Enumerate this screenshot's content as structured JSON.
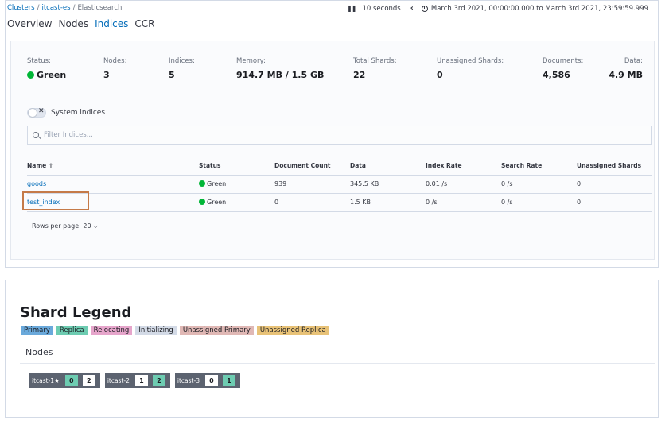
{
  "breadcrumb": [
    "Clusters",
    "itcast-es",
    "Elasticsearch"
  ],
  "time": {
    "refresh": "10 seconds",
    "range": "March 3rd 2021, 00:00:00.000 to March 3rd 2021, 23:59:59.999"
  },
  "tabs": [
    "Overview",
    "Nodes",
    "Indices",
    "CCR"
  ],
  "stats": [
    {
      "label": "Status:",
      "value": "Green"
    },
    {
      "label": "Nodes:",
      "value": "3"
    },
    {
      "label": "Indices:",
      "value": "5"
    },
    {
      "label": "Memory:",
      "value": "914.7 MB / 1.5 GB"
    },
    {
      "label": "Total Shards:",
      "value": "22"
    },
    {
      "label": "Unassigned Shards:",
      "value": "0"
    },
    {
      "label": "Documents:",
      "value": "4,586"
    },
    {
      "label": "Data:",
      "value": "4.9 MB"
    }
  ],
  "system_indices_label": "System indices",
  "filter_placeholder": "Filter Indices...",
  "table": {
    "headers": [
      "Name ↑",
      "Status",
      "Document Count",
      "Data",
      "Index Rate",
      "Search Rate",
      "Unassigned Shards"
    ],
    "rows": [
      [
        "goods",
        "Green",
        "939",
        "345.5 KB",
        "0.01 /s",
        "0 /s",
        "0"
      ],
      [
        "test_index",
        "Green",
        "0",
        "1.5 KB",
        "0 /s",
        "0 /s",
        "0"
      ]
    ]
  },
  "rows_per_page": "Rows per page: 20",
  "legend_title": "Shard Legend",
  "legend": [
    {
      "label": "Primary",
      "color": "#6aa9db"
    },
    {
      "label": "Replica",
      "color": "#6dccb1"
    },
    {
      "label": "Relocating",
      "color": "#e6a5cb"
    },
    {
      "label": "Initializing",
      "color": "#d3dae6"
    },
    {
      "label": "Unassigned Primary",
      "color": "#e0b8b5"
    },
    {
      "label": "Unassigned Replica",
      "color": "#e8c277"
    }
  ],
  "nodes_label": "Nodes",
  "nodes": [
    {
      "name": "itcast-1",
      "star": "★",
      "shards": [
        "0",
        "2"
      ]
    },
    {
      "name": "itcast-2",
      "star": "",
      "shards": [
        "1",
        "2"
      ]
    },
    {
      "name": "itcast-3",
      "star": "",
      "shards": [
        "0",
        "1"
      ]
    }
  ]
}
